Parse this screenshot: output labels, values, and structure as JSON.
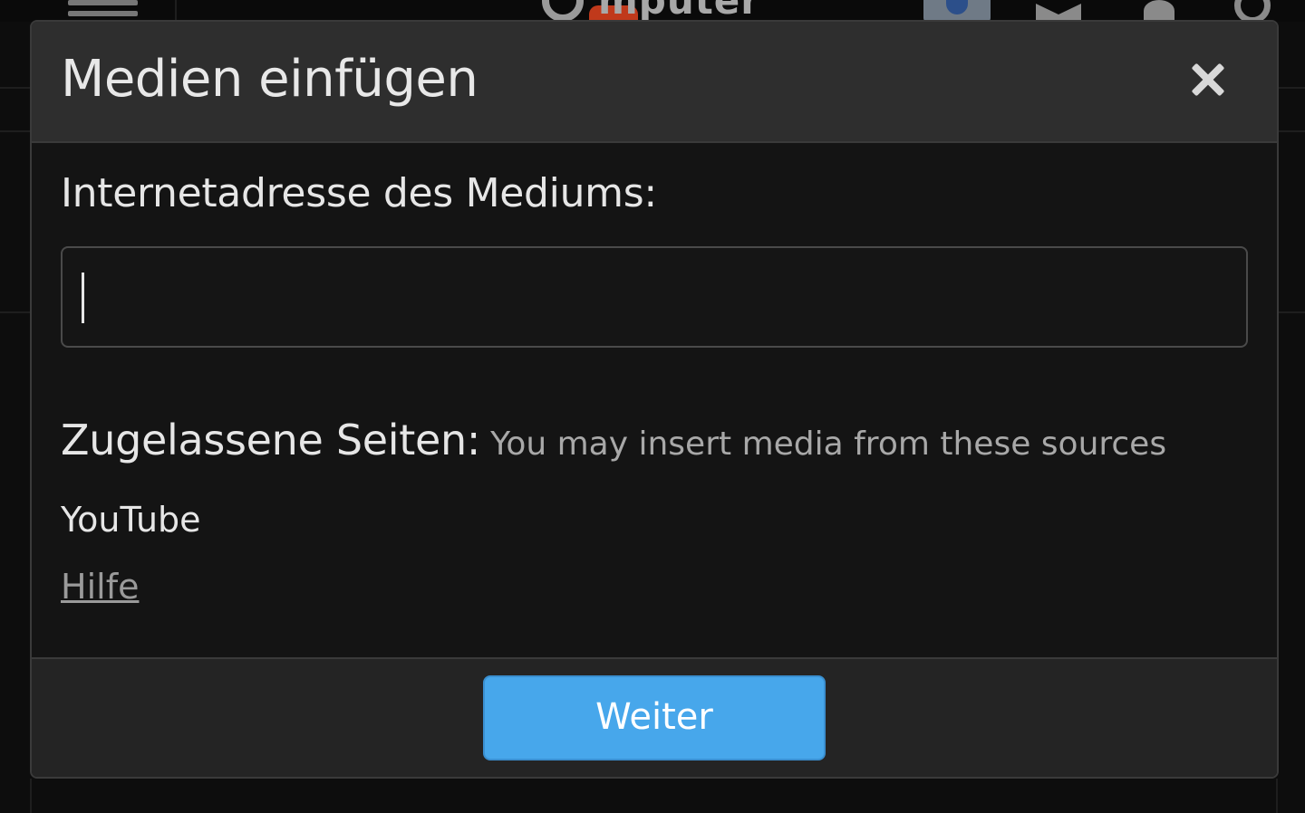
{
  "background": {
    "logo_text": "mputer"
  },
  "dialog": {
    "title": "Medien einfügen",
    "close_icon": "close-icon",
    "url_field": {
      "label": "Internetadresse des Mediums:",
      "value": "",
      "placeholder": ""
    },
    "allowed_sites": {
      "label": "Zugelassene Seiten:",
      "hint": "You may insert media from these sources",
      "items": [
        "YouTube"
      ]
    },
    "help_link": "Hilfe",
    "submit_label": "Weiter"
  },
  "colors": {
    "accent": "#47a7eb",
    "modal_header_bg": "#2e2e2e",
    "modal_body_bg": "#141414",
    "footer_bg": "#242424"
  }
}
